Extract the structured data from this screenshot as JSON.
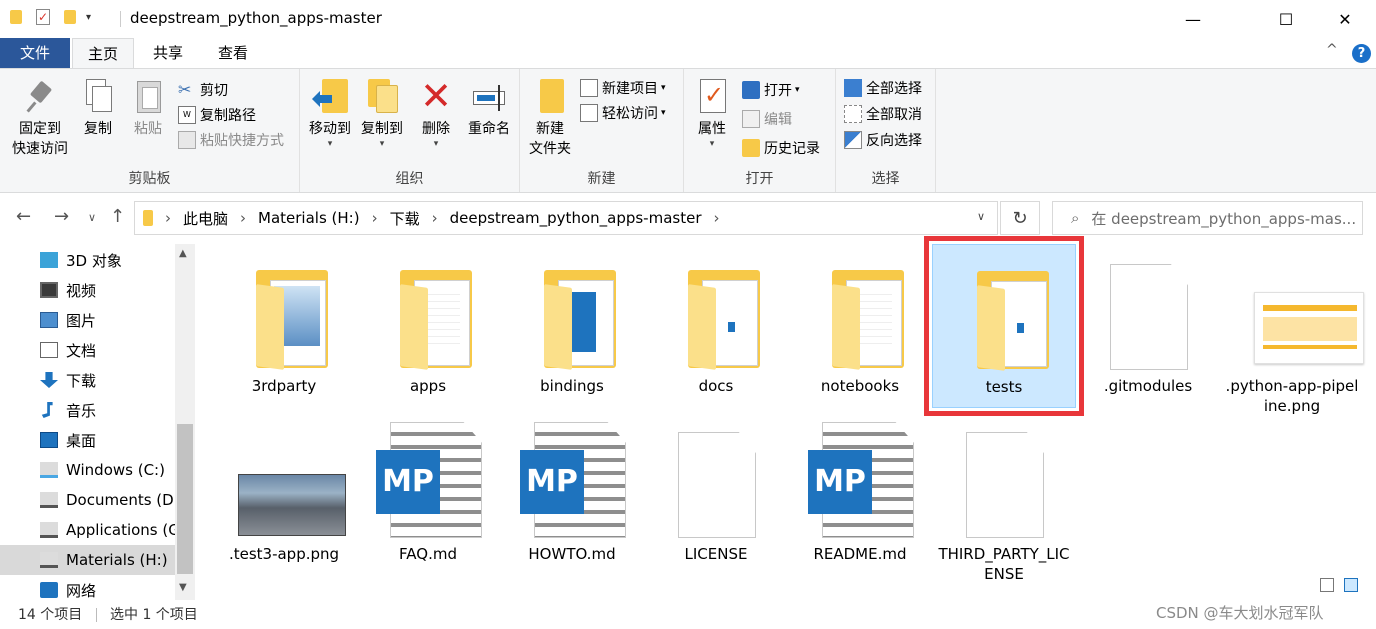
{
  "window": {
    "title": "deepstream_python_apps-master",
    "minimize": "—",
    "maximize": "☐",
    "close": "✕"
  },
  "menu": {
    "file": "文件",
    "home": "主页",
    "share": "共享",
    "view": "查看",
    "collapse": "^",
    "help": "?"
  },
  "ribbon": {
    "clipboard": {
      "label": "剪贴板",
      "pin_line1": "固定到",
      "pin_line2": "快速访问",
      "copy": "复制",
      "paste": "粘贴",
      "cut": "剪切",
      "copy_path": "复制路径",
      "paste_shortcut": "粘贴快捷方式"
    },
    "organize": {
      "label": "组织",
      "move_to": "移动到",
      "copy_to": "复制到",
      "delete": "删除",
      "rename": "重命名"
    },
    "new": {
      "label": "新建",
      "new_folder_line1": "新建",
      "new_folder_line2": "文件夹",
      "new_item": "新建项目",
      "easy_access": "轻松访问"
    },
    "open": {
      "label": "打开",
      "properties": "属性",
      "open": "打开",
      "edit": "编辑",
      "history": "历史记录"
    },
    "select": {
      "label": "选择",
      "select_all": "全部选择",
      "select_none": "全部取消",
      "invert": "反向选择"
    }
  },
  "address": {
    "crumbs": [
      "此电脑",
      "Materials (H:)",
      "下载",
      "deepstream_python_apps-master"
    ],
    "search_placeholder": "在 deepstream_python_apps-mas..."
  },
  "sidebar": {
    "items": [
      {
        "label": "3D 对象",
        "icon": "3d-objects-icon"
      },
      {
        "label": "视频",
        "icon": "video-icon"
      },
      {
        "label": "图片",
        "icon": "pictures-icon"
      },
      {
        "label": "文档",
        "icon": "documents-icon"
      },
      {
        "label": "下载",
        "icon": "download-icon"
      },
      {
        "label": "音乐",
        "icon": "music-icon"
      },
      {
        "label": "桌面",
        "icon": "desktop-icon"
      },
      {
        "label": "Windows (C:)",
        "icon": "windows-drive-icon"
      },
      {
        "label": "Documents (D:)",
        "icon": "drive-icon"
      },
      {
        "label": "Applications (G:)",
        "icon": "drive-icon"
      },
      {
        "label": "Materials (H:)",
        "icon": "drive-icon"
      },
      {
        "label": "网络",
        "icon": "network-icon"
      }
    ],
    "selected_index": 10
  },
  "files": [
    {
      "name": "3rdparty",
      "type": "folder-photo"
    },
    {
      "name": "apps",
      "type": "folder-docs"
    },
    {
      "name": "bindings",
      "type": "folder-mp"
    },
    {
      "name": "docs",
      "type": "folder-blue"
    },
    {
      "name": "notebooks",
      "type": "folder-docs"
    },
    {
      "name": "tests",
      "type": "folder-blue",
      "selected": true
    },
    {
      "name": ".gitmodules",
      "type": "blank"
    },
    {
      "name": ".python-app-pipeline.png",
      "type": "image-diagram"
    },
    {
      "name": ".test3-app.png",
      "type": "image-photo"
    },
    {
      "name": "FAQ.md",
      "type": "md"
    },
    {
      "name": "HOWTO.md",
      "type": "md"
    },
    {
      "name": "LICENSE",
      "type": "blank"
    },
    {
      "name": "README.md",
      "type": "md"
    },
    {
      "name": "THIRD_PARTY_LICENSE",
      "type": "blank"
    }
  ],
  "status": {
    "count": "14 个项目",
    "selected": "选中 1 个项目",
    "watermark": "CSDN @车大划水冠军队"
  },
  "colors": {
    "accent": "#2b579a",
    "selection_fill": "#cce8ff",
    "selection_border": "#e8363a",
    "folder": "#f7c948",
    "md_blue": "#1e73be"
  }
}
